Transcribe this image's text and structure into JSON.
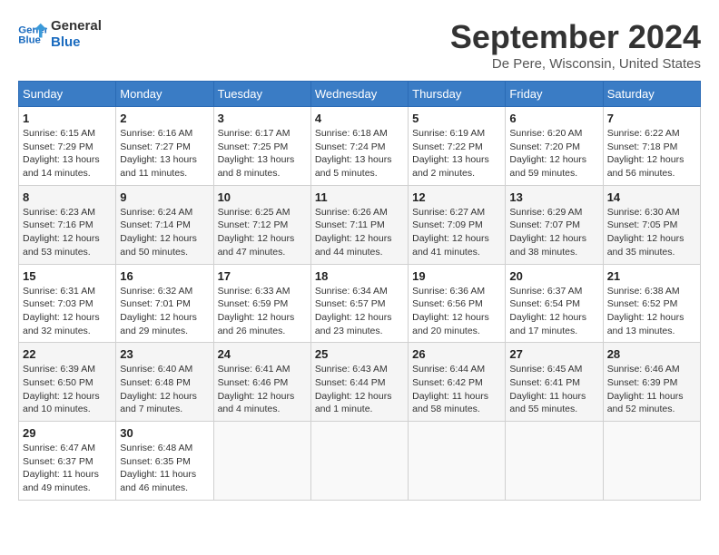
{
  "logo": {
    "line1": "General",
    "line2": "Blue"
  },
  "title": "September 2024",
  "location": "De Pere, Wisconsin, United States",
  "weekdays": [
    "Sunday",
    "Monday",
    "Tuesday",
    "Wednesday",
    "Thursday",
    "Friday",
    "Saturday"
  ],
  "weeks": [
    [
      {
        "day": "1",
        "info": "Sunrise: 6:15 AM\nSunset: 7:29 PM\nDaylight: 13 hours\nand 14 minutes."
      },
      {
        "day": "2",
        "info": "Sunrise: 6:16 AM\nSunset: 7:27 PM\nDaylight: 13 hours\nand 11 minutes."
      },
      {
        "day": "3",
        "info": "Sunrise: 6:17 AM\nSunset: 7:25 PM\nDaylight: 13 hours\nand 8 minutes."
      },
      {
        "day": "4",
        "info": "Sunrise: 6:18 AM\nSunset: 7:24 PM\nDaylight: 13 hours\nand 5 minutes."
      },
      {
        "day": "5",
        "info": "Sunrise: 6:19 AM\nSunset: 7:22 PM\nDaylight: 13 hours\nand 2 minutes."
      },
      {
        "day": "6",
        "info": "Sunrise: 6:20 AM\nSunset: 7:20 PM\nDaylight: 12 hours\nand 59 minutes."
      },
      {
        "day": "7",
        "info": "Sunrise: 6:22 AM\nSunset: 7:18 PM\nDaylight: 12 hours\nand 56 minutes."
      }
    ],
    [
      {
        "day": "8",
        "info": "Sunrise: 6:23 AM\nSunset: 7:16 PM\nDaylight: 12 hours\nand 53 minutes."
      },
      {
        "day": "9",
        "info": "Sunrise: 6:24 AM\nSunset: 7:14 PM\nDaylight: 12 hours\nand 50 minutes."
      },
      {
        "day": "10",
        "info": "Sunrise: 6:25 AM\nSunset: 7:12 PM\nDaylight: 12 hours\nand 47 minutes."
      },
      {
        "day": "11",
        "info": "Sunrise: 6:26 AM\nSunset: 7:11 PM\nDaylight: 12 hours\nand 44 minutes."
      },
      {
        "day": "12",
        "info": "Sunrise: 6:27 AM\nSunset: 7:09 PM\nDaylight: 12 hours\nand 41 minutes."
      },
      {
        "day": "13",
        "info": "Sunrise: 6:29 AM\nSunset: 7:07 PM\nDaylight: 12 hours\nand 38 minutes."
      },
      {
        "day": "14",
        "info": "Sunrise: 6:30 AM\nSunset: 7:05 PM\nDaylight: 12 hours\nand 35 minutes."
      }
    ],
    [
      {
        "day": "15",
        "info": "Sunrise: 6:31 AM\nSunset: 7:03 PM\nDaylight: 12 hours\nand 32 minutes."
      },
      {
        "day": "16",
        "info": "Sunrise: 6:32 AM\nSunset: 7:01 PM\nDaylight: 12 hours\nand 29 minutes."
      },
      {
        "day": "17",
        "info": "Sunrise: 6:33 AM\nSunset: 6:59 PM\nDaylight: 12 hours\nand 26 minutes."
      },
      {
        "day": "18",
        "info": "Sunrise: 6:34 AM\nSunset: 6:57 PM\nDaylight: 12 hours\nand 23 minutes."
      },
      {
        "day": "19",
        "info": "Sunrise: 6:36 AM\nSunset: 6:56 PM\nDaylight: 12 hours\nand 20 minutes."
      },
      {
        "day": "20",
        "info": "Sunrise: 6:37 AM\nSunset: 6:54 PM\nDaylight: 12 hours\nand 17 minutes."
      },
      {
        "day": "21",
        "info": "Sunrise: 6:38 AM\nSunset: 6:52 PM\nDaylight: 12 hours\nand 13 minutes."
      }
    ],
    [
      {
        "day": "22",
        "info": "Sunrise: 6:39 AM\nSunset: 6:50 PM\nDaylight: 12 hours\nand 10 minutes."
      },
      {
        "day": "23",
        "info": "Sunrise: 6:40 AM\nSunset: 6:48 PM\nDaylight: 12 hours\nand 7 minutes."
      },
      {
        "day": "24",
        "info": "Sunrise: 6:41 AM\nSunset: 6:46 PM\nDaylight: 12 hours\nand 4 minutes."
      },
      {
        "day": "25",
        "info": "Sunrise: 6:43 AM\nSunset: 6:44 PM\nDaylight: 12 hours\nand 1 minute."
      },
      {
        "day": "26",
        "info": "Sunrise: 6:44 AM\nSunset: 6:42 PM\nDaylight: 11 hours\nand 58 minutes."
      },
      {
        "day": "27",
        "info": "Sunrise: 6:45 AM\nSunset: 6:41 PM\nDaylight: 11 hours\nand 55 minutes."
      },
      {
        "day": "28",
        "info": "Sunrise: 6:46 AM\nSunset: 6:39 PM\nDaylight: 11 hours\nand 52 minutes."
      }
    ],
    [
      {
        "day": "29",
        "info": "Sunrise: 6:47 AM\nSunset: 6:37 PM\nDaylight: 11 hours\nand 49 minutes."
      },
      {
        "day": "30",
        "info": "Sunrise: 6:48 AM\nSunset: 6:35 PM\nDaylight: 11 hours\nand 46 minutes."
      },
      {
        "day": "",
        "info": ""
      },
      {
        "day": "",
        "info": ""
      },
      {
        "day": "",
        "info": ""
      },
      {
        "day": "",
        "info": ""
      },
      {
        "day": "",
        "info": ""
      }
    ]
  ]
}
